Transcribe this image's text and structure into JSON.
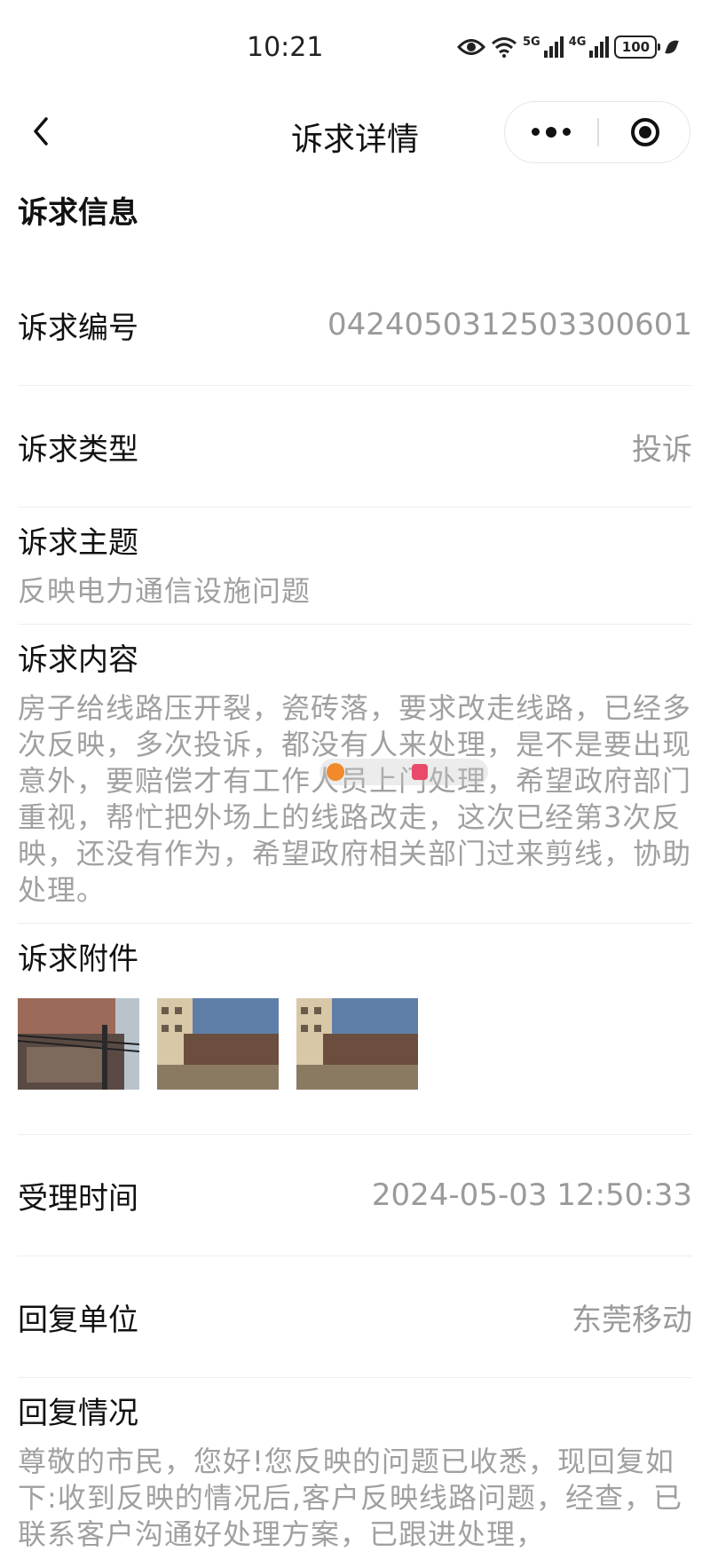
{
  "status_bar": {
    "time": "10:21",
    "net1": "5G",
    "net2": "4G",
    "battery": "100"
  },
  "nav": {
    "title": "诉求详情"
  },
  "section": {
    "title": "诉求信息"
  },
  "fields": {
    "number": {
      "label": "诉求编号",
      "value": "0424050312503300601"
    },
    "type": {
      "label": "诉求类型",
      "value": "投诉"
    },
    "subject": {
      "label": "诉求主题",
      "value": "反映电力通信设施问题"
    },
    "content": {
      "label": "诉求内容",
      "value": "房子给线路压开裂，瓷砖落，要求改走线路，已经多次反映，多次投诉，都没有人来处理，是不是要出现意外，要赔偿才有工作人员上门处理，希望政府部门重视，帮忙把外场上的线路改走，这次已经第3次反映，还没有作为，希望政府相关部门过来剪线，协助处理。"
    },
    "attachments": {
      "label": "诉求附件"
    },
    "accept_time": {
      "label": "受理时间",
      "value": "2024-05-03 12:50:33"
    },
    "reply_unit": {
      "label": "回复单位",
      "value": "东莞移动"
    },
    "reply": {
      "label": "回复情况",
      "value": "尊敬的市民，您好!您反映的问题已收悉，现回复如下:收到反映的情况后,客户反映线路问题，经查，已联系客户沟通好处理方案，已跟进处理，"
    }
  }
}
